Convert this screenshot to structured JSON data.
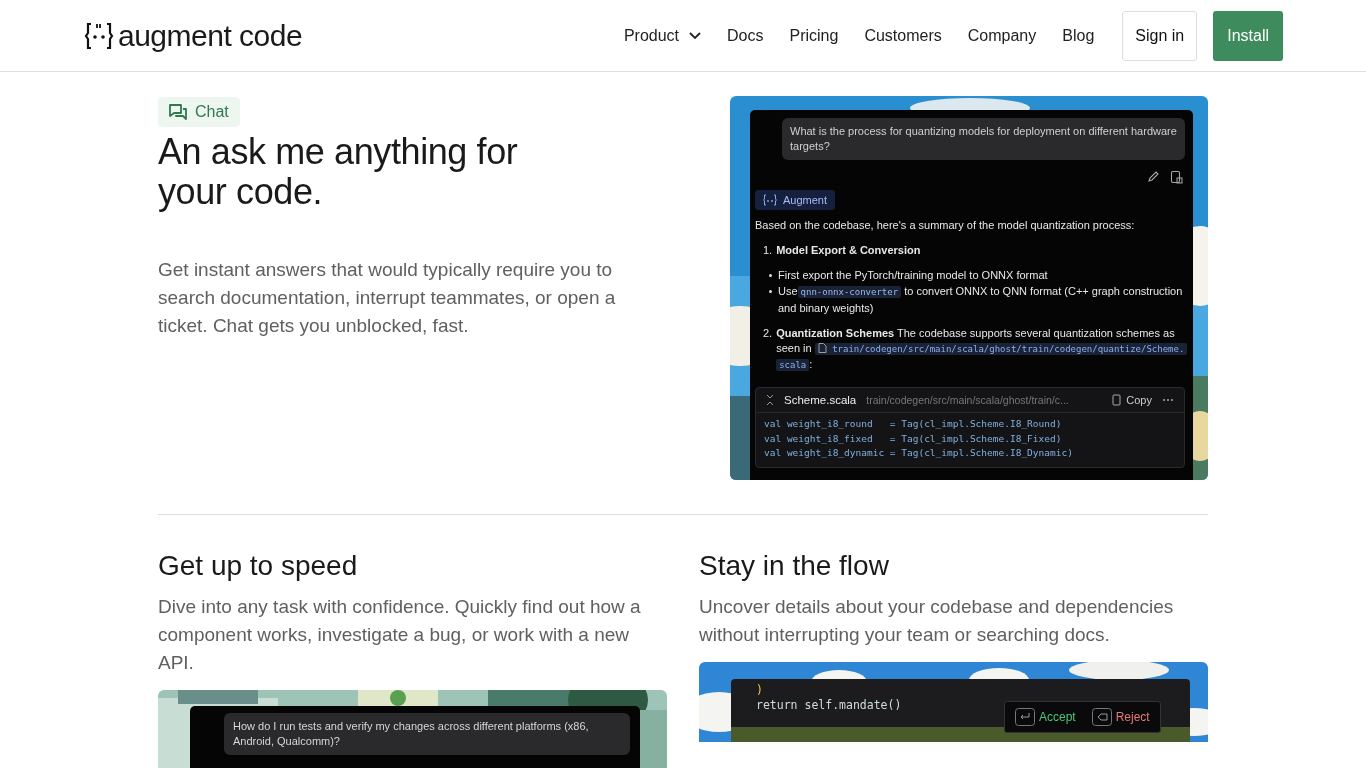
{
  "header": {
    "logo": "augment code",
    "nav": [
      {
        "label": "Product",
        "kind": "dropdown"
      },
      {
        "label": "Docs",
        "kind": "link"
      },
      {
        "label": "Pricing",
        "kind": "link"
      },
      {
        "label": "Customers",
        "kind": "link"
      },
      {
        "label": "Company",
        "kind": "link"
      },
      {
        "label": "Blog",
        "kind": "link"
      }
    ],
    "sign_in": "Sign in",
    "install": "Install"
  },
  "hero": {
    "tag": "Chat",
    "title_lines": [
      "An ask me anything for",
      "your code."
    ],
    "text": "Get instant answers that would typically require you to search documentation, interrupt teammates, or open a ticket. Chat gets you unblocked, fast.",
    "chat": {
      "question": "What is the process for quantizing models for deployment on different hardware targets?",
      "author": "Augment",
      "intro": "Based on the codebase, here's a summary of the model quantization process:",
      "step_1": {
        "number": "1.",
        "title": "Model Export & Conversion"
      },
      "bullets": [
        {
          "before": "First export the PyTorch/training model to ONNX format"
        },
        {
          "before": "Use",
          "code": "qnn-onnx-converter",
          "after": "to convert ONNX to QNN format (C++ graph construction and binary weights)"
        }
      ],
      "step_2": {
        "number": "2.",
        "title": "Quantization Schemes",
        "text": "The codebase supports several quantization schemes as seen in",
        "path": "train/codegen/src/main/scala/ghost/train/codegen/quantize/Scheme.scala",
        "after": ":"
      },
      "code_block": {
        "file": "Scheme.scala",
        "path": "train/codegen/src/main/scala/ghost/train/c...",
        "copy": "Copy",
        "lines": [
          "val weight_i8_round   = Tag(cl_impl.Scheme.I8_Round)",
          "val weight_i8_fixed   = Tag(cl_impl.Scheme.I8_Fixed)",
          "val weight_i8_dynamic = Tag(cl_impl.Scheme.I8_Dynamic)"
        ]
      }
    }
  },
  "features": [
    {
      "title": "Get up to speed",
      "text": "Dive into any task with confidence. Quickly find out how a component works, investigate a bug, or work with a new API.",
      "kind": "question",
      "question": "How do I run tests and verify my changes across different platforms (x86, Android, Qualcomm)?"
    },
    {
      "title": "Stay in the flow",
      "text": "Uncover details about your codebase and dependencies without interrupting your team or searching docs.",
      "kind": "diff",
      "code": [
        ")",
        "return self.mandate()"
      ],
      "accept": "Accept",
      "reject": "Reject"
    }
  ]
}
